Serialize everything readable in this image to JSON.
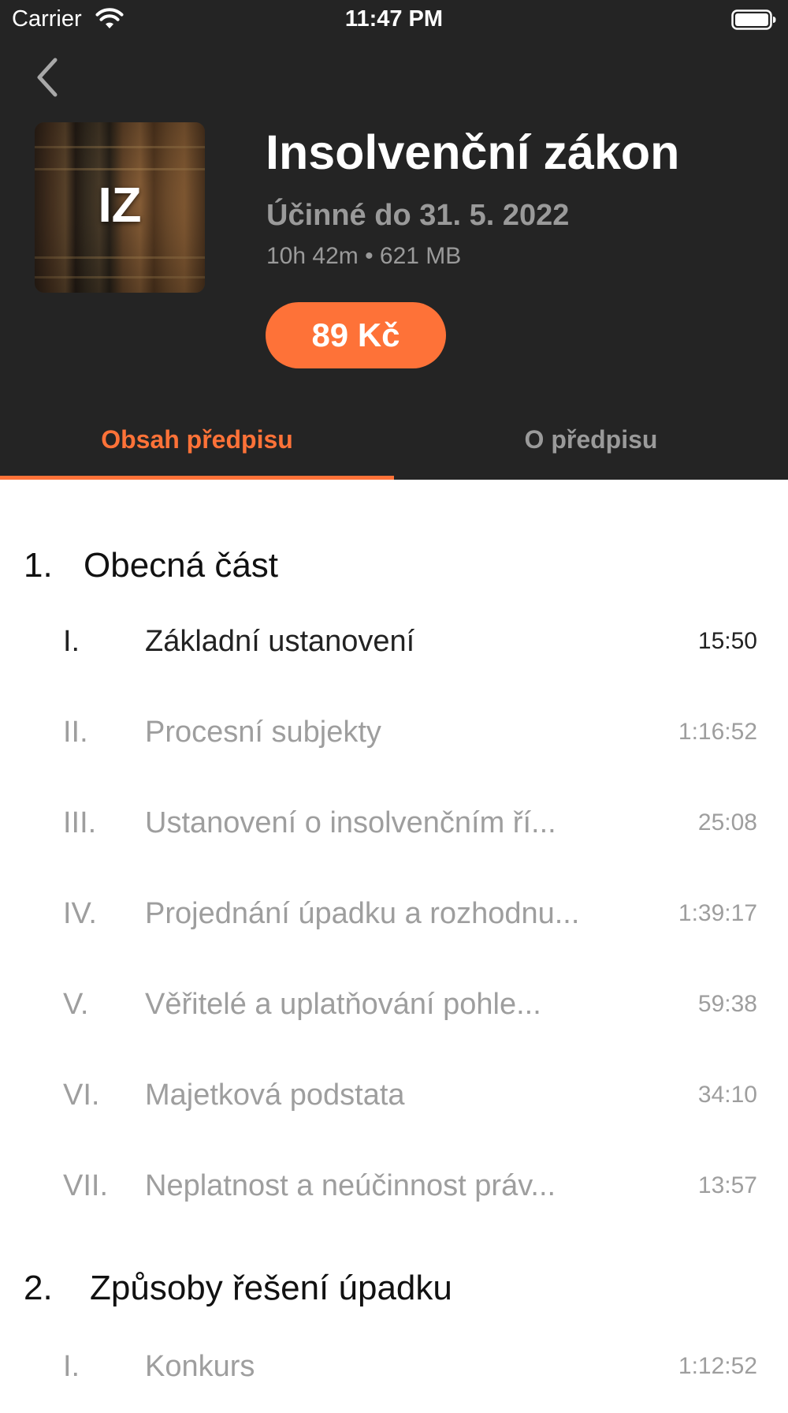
{
  "status_bar": {
    "carrier": "Carrier",
    "time": "11:47 PM"
  },
  "book": {
    "cover_initials": "IZ",
    "title": "Insolvenční zákon",
    "validity": "Účinné do 31. 5. 2022",
    "meta": "10h 42m • 621 MB",
    "price": "89 Kč"
  },
  "tabs": [
    {
      "label": "Obsah předpisu",
      "selected": true
    },
    {
      "label": "O předpisu",
      "selected": false
    }
  ],
  "sections": [
    {
      "number": "1.",
      "title": "Obecná část",
      "chapters": [
        {
          "number": "I.",
          "title": "Základní ustanovení",
          "duration": "15:50",
          "active": true
        },
        {
          "number": "II.",
          "title": "Procesní subjekty",
          "duration": "1:16:52",
          "active": false
        },
        {
          "number": "III.",
          "title": "Ustanovení o insolvenčním ří...",
          "duration": "25:08",
          "active": false
        },
        {
          "number": "IV.",
          "title": "Projednání úpadku a rozhodnu...",
          "duration": "1:39:17",
          "active": false
        },
        {
          "number": "V.",
          "title": "Věřitelé a uplatňování pohle...",
          "duration": "59:38",
          "active": false
        },
        {
          "number": "VI.",
          "title": "Majetková podstata",
          "duration": "34:10",
          "active": false
        },
        {
          "number": "VII.",
          "title": "Neplatnost a neúčinnost práv...",
          "duration": "13:57",
          "active": false
        }
      ]
    },
    {
      "number": "2.",
      "title": "Způsoby řešení úpadku",
      "chapters": [
        {
          "number": "I.",
          "title": "Konkurs",
          "duration": "1:12:52",
          "active": false
        }
      ]
    }
  ],
  "colors": {
    "accent": "#fe7238",
    "header_background": "#242424",
    "muted_text": "#9e9e9e"
  },
  "icons": {
    "back": "chevron-left-icon",
    "wifi": "wifi-icon",
    "battery": "battery-icon"
  }
}
